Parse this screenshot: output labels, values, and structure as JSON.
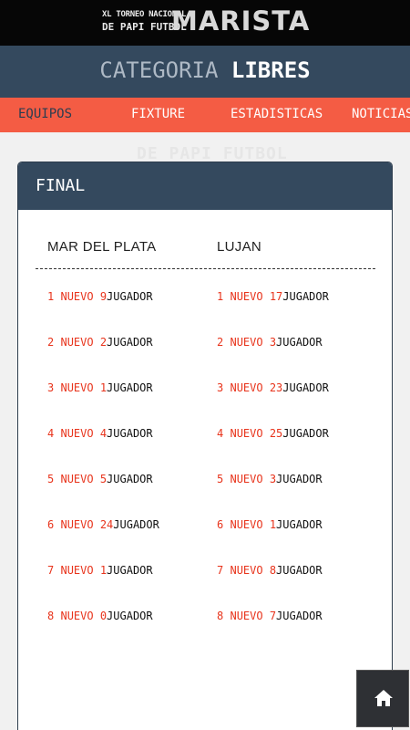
{
  "header": {
    "line1": "XL TORNEO NACIONAL",
    "line2": "DE PAPI FUTBOL",
    "brand": "MARISTA"
  },
  "category": {
    "prefix": "CATEGORIA",
    "name": "LIBRES"
  },
  "nav": {
    "items": [
      {
        "label": "EQUIPOS",
        "active": true
      },
      {
        "label": "FIXTURE",
        "active": false
      },
      {
        "label": "ESTADISTICAS",
        "active": false
      },
      {
        "label": "NOTICIAS",
        "active": false
      }
    ]
  },
  "background_text": "DE PAPI FUTBOL",
  "card": {
    "title": "FINAL",
    "left_team": {
      "name": "MAR DEL PLATA",
      "players": [
        {
          "num": "1",
          "label": "NUEVO 9",
          "role": "JUGADOR"
        },
        {
          "num": "2",
          "label": "NUEVO 2",
          "role": "JUGADOR"
        },
        {
          "num": "3",
          "label": "NUEVO 1",
          "role": "JUGADOR"
        },
        {
          "num": "4",
          "label": "NUEVO 4",
          "role": "JUGADOR"
        },
        {
          "num": "5",
          "label": "NUEVO 5",
          "role": "JUGADOR"
        },
        {
          "num": "6",
          "label": "NUEVO 24",
          "role": "JUGADOR"
        },
        {
          "num": "7",
          "label": "NUEVO 1",
          "role": "JUGADOR"
        },
        {
          "num": "8",
          "label": "NUEVO 0",
          "role": "JUGADOR"
        }
      ]
    },
    "right_team": {
      "name": "LUJAN",
      "players": [
        {
          "num": "1",
          "label": "NUEVO 17",
          "role": "JUGADOR"
        },
        {
          "num": "2",
          "label": "NUEVO 3",
          "role": "JUGADOR"
        },
        {
          "num": "3",
          "label": "NUEVO 23",
          "role": "JUGADOR"
        },
        {
          "num": "4",
          "label": "NUEVO 25",
          "role": "JUGADOR"
        },
        {
          "num": "5",
          "label": "NUEVO 3",
          "role": "JUGADOR"
        },
        {
          "num": "6",
          "label": "NUEVO 1",
          "role": "JUGADOR"
        },
        {
          "num": "7",
          "label": "NUEVO 8",
          "role": "JUGADOR"
        },
        {
          "num": "8",
          "label": "NUEVO 7",
          "role": "JUGADOR"
        }
      ]
    }
  },
  "icons": {
    "home": "home-icon"
  },
  "colors": {
    "accent": "#f45c44",
    "header_blue": "#34495e",
    "player_red": "#e8341c"
  }
}
